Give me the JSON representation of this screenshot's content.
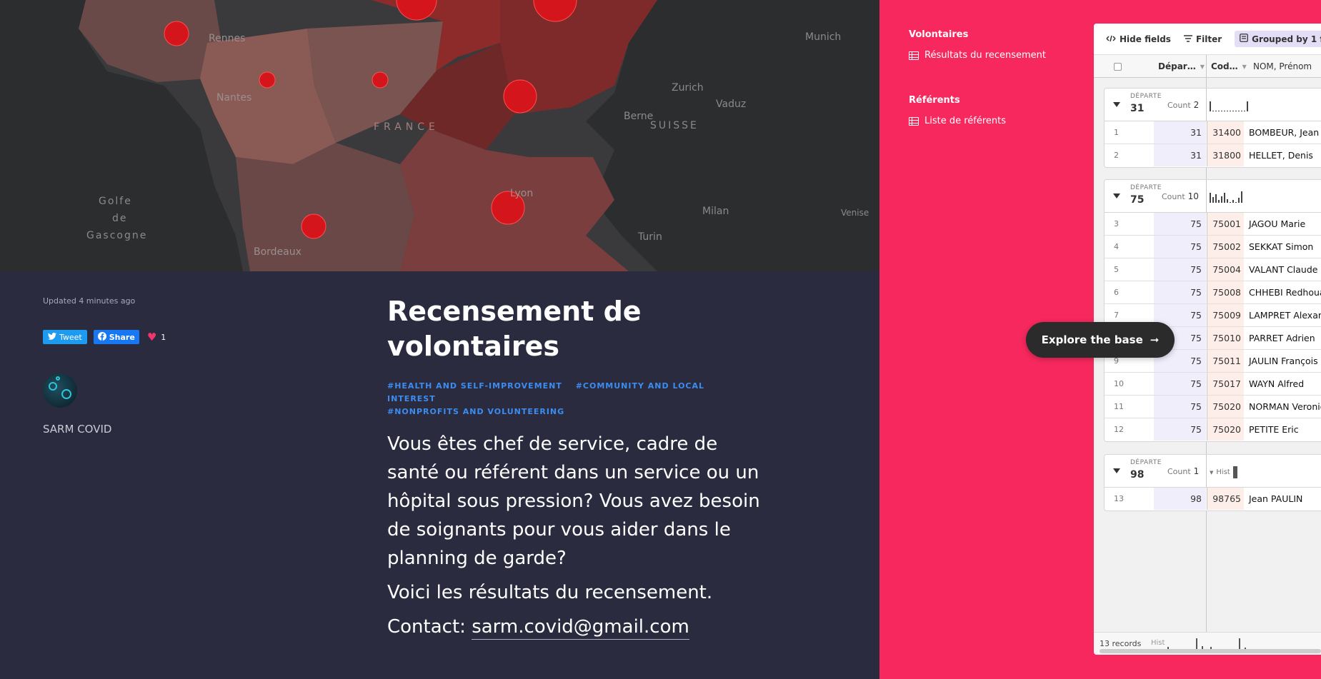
{
  "map": {
    "labels": {
      "rennes": "Rennes",
      "nantes": "Nantes",
      "france": "FRANCE",
      "golfe": "Golfe",
      "de": "de",
      "gascogne": "Gascogne",
      "bordeaux": "Bordeaux",
      "lyon": "Lyon",
      "munich": "Munich",
      "zurich": "Zurich",
      "vaduz": "Vaduz",
      "berne": "Berne",
      "suisse": "SUISSE",
      "milan": "Milan",
      "turin": "Turin",
      "venise": "Venise"
    }
  },
  "info": {
    "updated": "Updated 4 minutes ago",
    "tweet_label": "Tweet",
    "share_label": "Share",
    "likes": "1",
    "author": "SARM COVID",
    "title": "Recensement de volontaires",
    "tags": [
      "#HEALTH AND SELF-IMPROVEMENT",
      "#COMMUNITY AND LOCAL INTEREST",
      "#NONPROFITS AND VOLUNTEERING"
    ],
    "desc1": "Vous êtes chef de service, cadre de santé ou référent dans un service ou un hôpital sous pression? Vous avez besoin de soignants pour vous aider dans le planning de garde?",
    "desc2": "Voici les résultats du recensement.",
    "contact_prefix": "Contact: ",
    "email": "sarm.covid@gmail.com"
  },
  "nav": {
    "sections": [
      {
        "head": "Volontaires",
        "item": "Résultats du recensement"
      },
      {
        "head": "Référents",
        "item": "Liste de référents"
      }
    ]
  },
  "explore_label": "Explore the base",
  "airtable": {
    "toolbar": {
      "hide_fields": "Hide fields",
      "filter": "Filter",
      "grouped": "Grouped by 1 field"
    },
    "columns": {
      "dep": "Dépar…",
      "code": "Cod…",
      "name": "NOM, Prénom"
    },
    "group_label": "DÉPARTE",
    "count_label": "Count",
    "hist_label": "Hist",
    "groups": [
      {
        "value": "31",
        "count": "2",
        "rows": [
          {
            "n": "1",
            "dep": "31",
            "code": "31400",
            "name": "BOMBEUR, Jean"
          },
          {
            "n": "2",
            "dep": "31",
            "code": "31800",
            "name": "HELLET, Denis"
          }
        ]
      },
      {
        "value": "75",
        "count": "10",
        "rows": [
          {
            "n": "3",
            "dep": "75",
            "code": "75001",
            "name": "JAGOU Marie"
          },
          {
            "n": "4",
            "dep": "75",
            "code": "75002",
            "name": "SEKKAT Simon"
          },
          {
            "n": "5",
            "dep": "75",
            "code": "75004",
            "name": "VALANT Claude"
          },
          {
            "n": "6",
            "dep": "75",
            "code": "75008",
            "name": "CHHEBI Redhouane"
          },
          {
            "n": "7",
            "dep": "75",
            "code": "75009",
            "name": "LAMPRET Alexandre"
          },
          {
            "n": "8",
            "dep": "75",
            "code": "75010",
            "name": "PARRET Adrien"
          },
          {
            "n": "9",
            "dep": "75",
            "code": "75011",
            "name": "JAULIN François"
          },
          {
            "n": "10",
            "dep": "75",
            "code": "75017",
            "name": "WAYN Alfred"
          },
          {
            "n": "11",
            "dep": "75",
            "code": "75020",
            "name": "NORMAN Veronique"
          },
          {
            "n": "12",
            "dep": "75",
            "code": "75020",
            "name": "PETITE Eric"
          }
        ]
      },
      {
        "value": "98",
        "count": "1",
        "rows": [
          {
            "n": "13",
            "dep": "98",
            "code": "98765",
            "name": "Jean PAULIN"
          }
        ]
      }
    ],
    "footer_records": "13 records",
    "footer_hist": "Hist"
  },
  "colors": {
    "pink": "#f7285e",
    "dark_panel": "#2a2b3f",
    "tag_blue": "#3d8cf0",
    "map_dot": "#d4151b"
  }
}
